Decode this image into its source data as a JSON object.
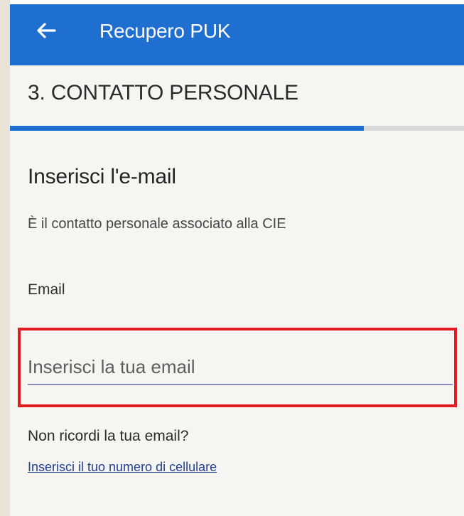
{
  "app_bar": {
    "back_icon": "arrow-left-icon",
    "title": "Recupero PUK"
  },
  "step": {
    "title": "3. CONTATTO PERSONALE",
    "progress": 0.78
  },
  "form": {
    "heading": "Inserisci l'e-mail",
    "subtitle": "È il contatto personale associato alla CIE",
    "email_label": "Email",
    "email_placeholder": "Inserisci la tua email",
    "email_value": ""
  },
  "help": {
    "forgot_text": "Non ricordi la tua email?",
    "phone_link": "Inserisci il tuo numero di cellulare"
  },
  "colors": {
    "brand": "#1f6fd1",
    "highlight": "#e21d21",
    "link": "#1f3f96"
  }
}
